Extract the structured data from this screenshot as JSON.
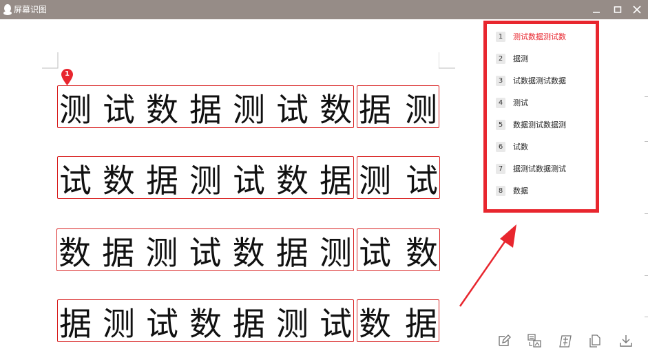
{
  "window": {
    "title": "屏幕识图",
    "minimize_label": "—",
    "maximize_label": "□",
    "close_label": "✕"
  },
  "ocr_lines": [
    {
      "segments": [
        [
          "测",
          "试",
          "数",
          "据",
          "测",
          "试",
          "数"
        ],
        [
          "据",
          "测"
        ]
      ]
    },
    {
      "segments": [
        [
          "试",
          "数",
          "据",
          "测",
          "试",
          "数",
          "据"
        ],
        [
          "测",
          "试"
        ]
      ]
    },
    {
      "segments": [
        [
          "数",
          "据",
          "测",
          "试",
          "数",
          "据",
          "测"
        ],
        [
          "试",
          "数"
        ]
      ]
    },
    {
      "segments": [
        [
          "据",
          "测",
          "试",
          "数",
          "据",
          "测",
          "试"
        ],
        [
          "数",
          "据"
        ]
      ]
    }
  ],
  "marker": {
    "label": "1"
  },
  "results_panel": {
    "items": [
      {
        "num": "1",
        "text": "测试数据测试数",
        "active": true
      },
      {
        "num": "2",
        "text": "据测",
        "active": false
      },
      {
        "num": "3",
        "text": "试数据测试数据",
        "active": false
      },
      {
        "num": "4",
        "text": "测试",
        "active": false
      },
      {
        "num": "5",
        "text": "数据测试数据测",
        "active": false
      },
      {
        "num": "6",
        "text": "试数",
        "active": false
      },
      {
        "num": "7",
        "text": "据测试数据测试",
        "active": false
      },
      {
        "num": "8",
        "text": "数据",
        "active": false
      }
    ]
  },
  "toolbar": {
    "icons": [
      "edit-icon",
      "image-text-icon",
      "translate-icon",
      "copy-icon",
      "download-icon"
    ]
  },
  "colors": {
    "titlebar": "#968c87",
    "accent_red": "#e8262e",
    "box_red": "#d81f1f"
  }
}
